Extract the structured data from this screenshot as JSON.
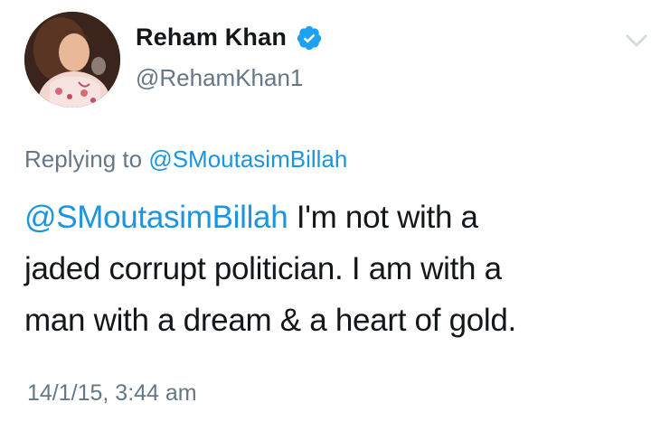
{
  "author": {
    "display_name": "Reham Khan",
    "handle": "@RehamKhan1",
    "verified": true,
    "verified_color": "#1da1f2"
  },
  "reply_context": {
    "prefix": "Replying to",
    "mention": "@SMoutasimBillah"
  },
  "tweet": {
    "mention": "@SMoutasimBillah",
    "line1_rest": " I'm not with a",
    "line2": "jaded corrupt politician. I am with a",
    "line3": "man with a dream & a heart of gold."
  },
  "timestamp": "14/1/15, 3:44 am",
  "icons": {
    "avatar": "profile-photo",
    "verified": "verified-badge-icon",
    "caret": "chevron-down-icon"
  },
  "colors": {
    "link": "#1b95e0",
    "muted": "#657786",
    "text": "#14171a"
  }
}
